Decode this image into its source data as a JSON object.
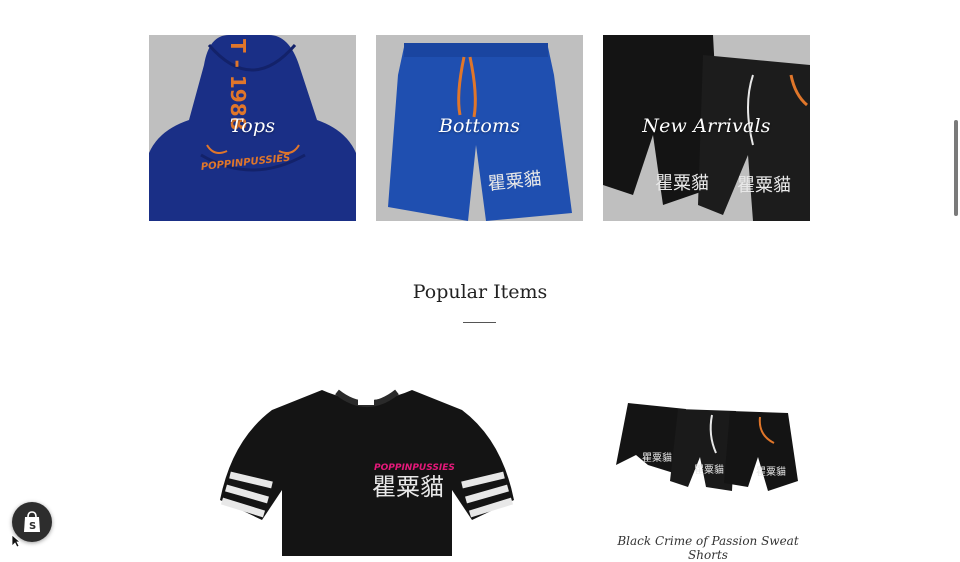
{
  "collections": [
    {
      "label": "Tops"
    },
    {
      "label": "Bottoms"
    },
    {
      "label": "New Arrivals"
    }
  ],
  "popular": {
    "title": "Popular Items",
    "products": [
      {
        "name": ""
      },
      {
        "name": "Black Crime of Passion Sweat Shorts"
      }
    ]
  },
  "images": {
    "hoodie_print_vertical": "T - 1988",
    "hoodie_brand": "POPPINPUSSIES",
    "shorts_print": "瞿粟貓",
    "tee_brand": "POPPINPUSSIES",
    "tee_print": "瞿粟貓"
  },
  "colors": {
    "tile_bg": "#bfbfbf",
    "hoodie_blue": "#1a2f86",
    "shorts_blue": "#1f4fb0",
    "orange": "#e0762a",
    "black_garment": "#141414",
    "pink": "#e5197a"
  },
  "icons": {
    "shopify_badge": "shopify-bag-icon",
    "cursor": "arrow-cursor-icon"
  }
}
